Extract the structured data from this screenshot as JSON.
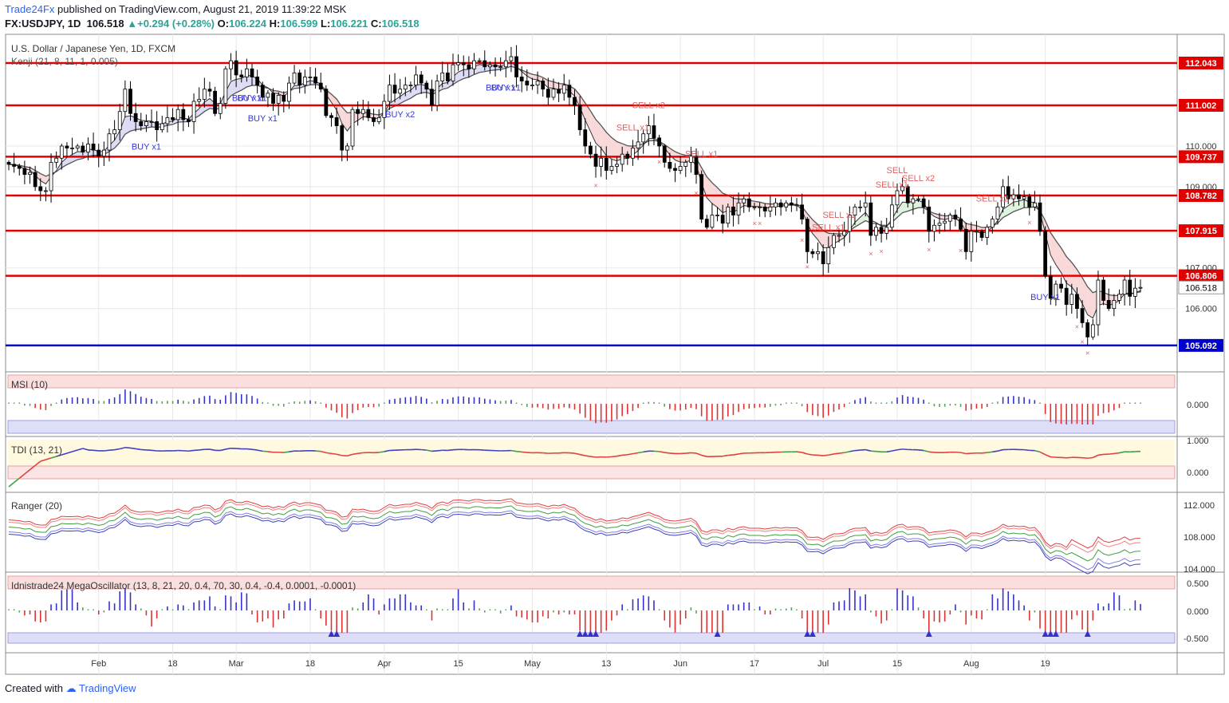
{
  "header": {
    "publisher": "Trade24Fx",
    "published_text": "published on TradingView.com, August 21, 2019 11:39:22 MSK",
    "symbol": "FX:USDJPY, 1D",
    "last": "106.518",
    "change": "+0.294 (+0.28%)",
    "o_label": "O:",
    "o": "106.224",
    "h_label": "H:",
    "h": "106.599",
    "l_label": "L:",
    "l": "106.221",
    "c_label": "C:",
    "c": "106.518"
  },
  "footer": {
    "created_with": "Created with",
    "brand": "TradingView"
  },
  "colors": {
    "up": "#ffffff",
    "down": "#000000",
    "level": "#e00000",
    "support": "#0000cc",
    "buy": "#3a3ad9",
    "sell": "#e06060",
    "grid": "#e8e8e8"
  },
  "chart_data": {
    "type": "candlestick",
    "title": "U.S. Dollar / Japanese Yen, 1D, FXCM",
    "indicator": "Kenji (21, 8, 11, 1, 0.005)",
    "x_ticks": [
      "Feb",
      "18",
      "Mar",
      "18",
      "Apr",
      "15",
      "May",
      "13",
      "Jun",
      "17",
      "Jul",
      "15",
      "Aug",
      "19"
    ],
    "x_tick_index": [
      17,
      31,
      43,
      57,
      71,
      85,
      99,
      113,
      127,
      141,
      154,
      168,
      182,
      196
    ],
    "y_ticks": [
      "110.000",
      "109.000",
      "107.000",
      "106.000"
    ],
    "y_tick_values": [
      110.0,
      109.0,
      107.0,
      106.0
    ],
    "ylim": [
      104.5,
      112.75
    ],
    "last_price": "106.518",
    "levels": [
      {
        "label": "112.043",
        "value": 112.043,
        "color": "red"
      },
      {
        "label": "111.002",
        "value": 111.002,
        "color": "red"
      },
      {
        "label": "109.737",
        "value": 109.737,
        "color": "red"
      },
      {
        "label": "108.782",
        "value": 108.782,
        "color": "red"
      },
      {
        "label": "107.915",
        "value": 107.915,
        "color": "red"
      },
      {
        "label": "106.806",
        "value": 106.806,
        "color": "red"
      },
      {
        "label": "105.092",
        "value": 105.092,
        "color": "blue"
      }
    ],
    "close": [
      109.55,
      109.5,
      109.45,
      109.3,
      109.35,
      109.0,
      108.9,
      108.9,
      109.6,
      109.7,
      110.0,
      109.95,
      109.95,
      110.0,
      109.85,
      110.05,
      109.9,
      109.75,
      109.9,
      110.3,
      110.4,
      110.85,
      111.4,
      110.8,
      110.6,
      110.5,
      110.6,
      110.6,
      110.4,
      110.55,
      110.7,
      110.65,
      110.9,
      110.65,
      110.6,
      111.1,
      111.15,
      111.4,
      111.35,
      110.8,
      111.05,
      111.9,
      112.1,
      111.75,
      111.7,
      111.9,
      111.7,
      111.5,
      111.2,
      111.3,
      111.05,
      111.25,
      111.1,
      111.55,
      111.8,
      111.5,
      111.7,
      111.7,
      111.55,
      111.4,
      110.75,
      110.7,
      110.5,
      109.9,
      110.0,
      110.9,
      110.8,
      110.9,
      110.7,
      110.6,
      110.7,
      111.1,
      111.5,
      111.3,
      111.4,
      111.5,
      111.5,
      111.75,
      111.55,
      111.4,
      111.0,
      111.6,
      111.8,
      111.6,
      112.0,
      112.05,
      112.0,
      111.9,
      112.1,
      112.1,
      111.95,
      112.0,
      111.95,
      111.95,
      112.1,
      112.2,
      111.7,
      111.6,
      111.5,
      111.5,
      111.6,
      111.4,
      111.2,
      111.4,
      111.3,
      111.5,
      111.2,
      111.0,
      110.4,
      110.0,
      109.8,
      109.5,
      109.7,
      109.4,
      109.5,
      109.55,
      109.8,
      109.7,
      109.95,
      110.1,
      110.3,
      110.5,
      110.2,
      110.0,
      109.6,
      109.45,
      109.4,
      109.5,
      109.6,
      109.75,
      109.3,
      108.2,
      108.0,
      108.3,
      108.3,
      108.1,
      108.5,
      108.3,
      108.6,
      108.7,
      108.5,
      108.5,
      108.5,
      108.4,
      108.5,
      108.6,
      108.5,
      108.6,
      108.55,
      108.55,
      108.2,
      107.4,
      107.35,
      107.4,
      107.1,
      107.5,
      107.8,
      107.8,
      107.9,
      108.3,
      108.5,
      108.5,
      108.6,
      107.8,
      108.0,
      107.85,
      108.0,
      108.55,
      108.9,
      109.0,
      108.6,
      108.7,
      108.7,
      108.5,
      107.9,
      108.05,
      108.1,
      108.15,
      108.3,
      108.2,
      107.95,
      107.4,
      107.9,
      107.9,
      107.75,
      108.0,
      108.2,
      108.5,
      109.0,
      108.7,
      108.8,
      108.7,
      108.75,
      108.5,
      108.6,
      107.9,
      106.8,
      106.25,
      106.6,
      106.5,
      106.1,
      106.35,
      106.0,
      105.65,
      105.3,
      105.6,
      106.7,
      106.2,
      106.0,
      106.2,
      106.35,
      106.7,
      106.3,
      106.5,
      106.52
    ],
    "markers": [
      {
        "i": 26,
        "side": "buy",
        "text": "BUY x1"
      },
      {
        "i": 45,
        "side": "buy",
        "text": "BUY x1"
      },
      {
        "i": 46,
        "side": "buy",
        "text": "BUY x1"
      },
      {
        "i": 48,
        "side": "buy",
        "text": "BUY x1"
      },
      {
        "i": 74,
        "side": "buy",
        "text": "BUY x2"
      },
      {
        "i": 93,
        "side": "buy",
        "text": "BUY x1"
      },
      {
        "i": 94,
        "side": "buy",
        "text": "BUY x1"
      },
      {
        "i": 118,
        "side": "sell",
        "text": "SELL x1"
      },
      {
        "i": 121,
        "side": "sell",
        "text": "SELL x2"
      },
      {
        "i": 131,
        "side": "sell",
        "text": "SELL x1"
      },
      {
        "i": 155,
        "side": "sell",
        "text": "SELL x1"
      },
      {
        "i": 157,
        "side": "sell",
        "text": "SELL x1"
      },
      {
        "i": 167,
        "side": "sell",
        "text": "SELL x1"
      },
      {
        "i": 168,
        "side": "sell",
        "text": "SELL"
      },
      {
        "i": 172,
        "side": "sell",
        "text": "SELL x2"
      },
      {
        "i": 186,
        "side": "sell",
        "text": "SELL x2"
      },
      {
        "i": 196,
        "side": "buy",
        "text": "BUY x1"
      },
      {
        "i": 215,
        "side": "sell",
        "text": "SELL x1"
      },
      {
        "i": 221,
        "side": "sell",
        "text": "SELL x1"
      }
    ],
    "panels": [
      {
        "name": "MSI (10)",
        "y_ticks": [
          "0.000"
        ]
      },
      {
        "name": "TDI (13, 21)",
        "y_ticks": [
          "1.000",
          "0.000"
        ]
      },
      {
        "name": "Ranger (20)",
        "y_ticks": [
          "112.000",
          "108.000",
          "104.000"
        ]
      },
      {
        "name": "Idnistrade24 MegaOscillator (13, 8, 21, 20, 0.4, 70, 30, 0.4, -0.4, 0.0001, -0.0001)",
        "y_ticks": [
          "0.500",
          "0.000",
          "-0.500"
        ]
      }
    ]
  }
}
